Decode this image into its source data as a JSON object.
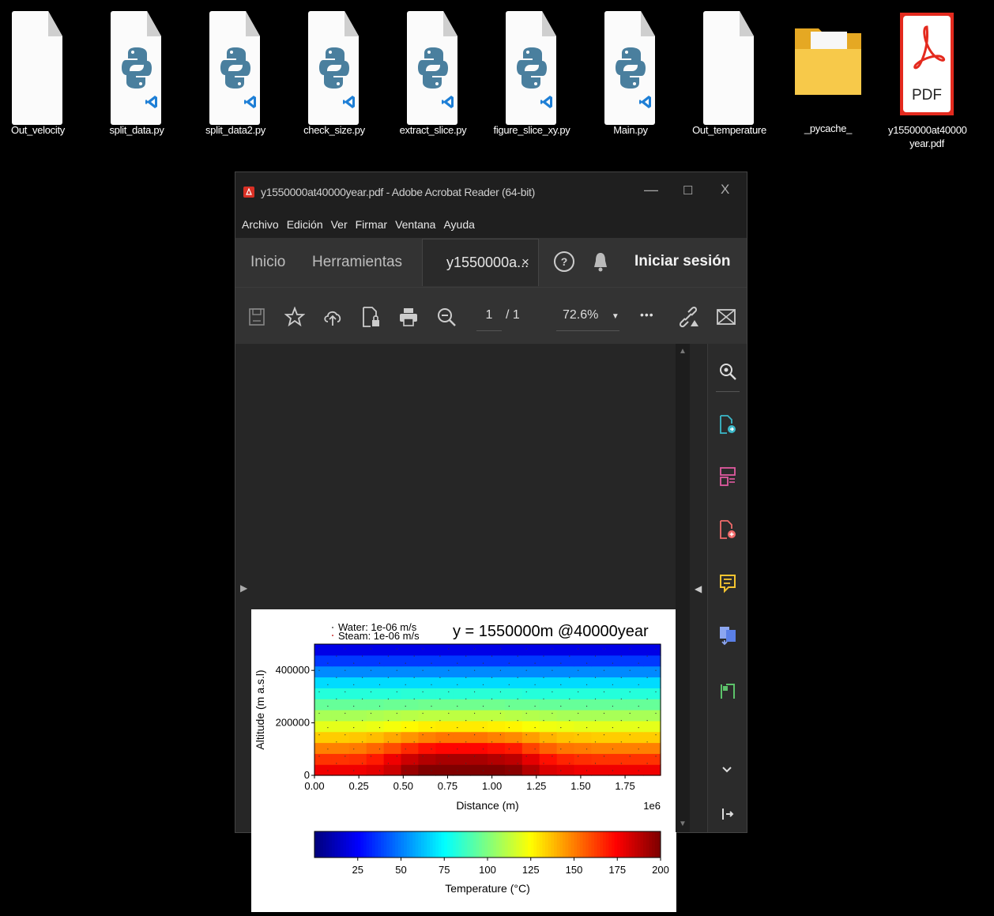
{
  "desktop": {
    "icons": [
      {
        "label": "Out_velocity",
        "kind": "blank"
      },
      {
        "label": "split_data.py",
        "kind": "python"
      },
      {
        "label": "split_data2.py",
        "kind": "python"
      },
      {
        "label": "check_size.py",
        "kind": "python"
      },
      {
        "label": "extract_slice.py",
        "kind": "python"
      },
      {
        "label": "figure_slice_xy.py",
        "kind": "python"
      },
      {
        "label": "Main.py",
        "kind": "python"
      },
      {
        "label": "Out_temperature",
        "kind": "blank"
      },
      {
        "label": "_pycache_",
        "kind": "folder"
      },
      {
        "label": "y1550000at40000 year.pdf",
        "kind": "pdf"
      }
    ],
    "pdf_badge": "PDF"
  },
  "window": {
    "title": "y1550000at40000year.pdf - Adobe Acrobat Reader (64-bit)",
    "menu": [
      "Archivo",
      "Edición",
      "Ver",
      "Firmar",
      "Ventana",
      "Ayuda"
    ],
    "tabs": {
      "home": "Inicio",
      "tools": "Herramientas",
      "doc": "y1550000a...",
      "close": "×",
      "signin": "Iniciar sesión"
    },
    "toolbar": {
      "page_current": "1",
      "page_total": "/ 1",
      "zoom": "72.6%",
      "more": "•••"
    }
  },
  "figure": {
    "legend_water": "Water: 1e-06 m/s",
    "legend_steam": "Steam: 1e-06 m/s",
    "title": "y = 1550000m @40000year",
    "ylabel": "Altitude (m a.s.l)",
    "xlabel": "Distance (m)",
    "x_offset": "1e6",
    "cbar_label": "Temperature (°C)"
  },
  "chart_data": {
    "type": "heatmap",
    "title": "y = 1550000m @40000year",
    "xlabel": "Distance (m)",
    "ylabel": "Altitude (m a.s.l)",
    "x_ticks": [
      "0.00",
      "0.25",
      "0.50",
      "0.75",
      "1.00",
      "1.25",
      "1.50",
      "1.75"
    ],
    "x_ticks_values": [
      0,
      0.25,
      0.5,
      0.75,
      1.0,
      1.25,
      1.5,
      1.75
    ],
    "x_scale_label": "1e6",
    "y_ticks": [
      "0",
      "200000",
      "400000"
    ],
    "y_ticks_values": [
      0,
      200000,
      400000
    ],
    "xlim": [
      0,
      1.95
    ],
    "ylim": [
      0,
      500000
    ],
    "colorbar": {
      "label": "Temperature (°C)",
      "ticks": [
        "25",
        "50",
        "75",
        "100",
        "125",
        "150",
        "175",
        "200"
      ],
      "tick_values": [
        25,
        50,
        75,
        100,
        125,
        150,
        175,
        200
      ],
      "range": [
        0,
        200
      ],
      "colormap": "jet"
    },
    "legend": [
      "Water: 1e-06 m/s",
      "Steam: 1e-06 m/s"
    ],
    "bands_temperature_bottom_to_top": [
      [
        178,
        178,
        178,
        180,
        185,
        195,
        200,
        200,
        200,
        200,
        200,
        198,
        190,
        182,
        180,
        178,
        178,
        178,
        178,
        178
      ],
      [
        165,
        165,
        166,
        170,
        178,
        185,
        190,
        192,
        192,
        192,
        190,
        188,
        180,
        172,
        168,
        166,
        165,
        165,
        165,
        165
      ],
      [
        150,
        150,
        151,
        155,
        160,
        167,
        172,
        174,
        174,
        174,
        172,
        170,
        162,
        156,
        152,
        151,
        150,
        150,
        150,
        150
      ],
      [
        135,
        135,
        136,
        138,
        142,
        146,
        150,
        152,
        152,
        152,
        150,
        148,
        144,
        140,
        137,
        136,
        135,
        135,
        135,
        135
      ],
      [
        120,
        120,
        120,
        121,
        123,
        126,
        128,
        129,
        129,
        129,
        128,
        127,
        124,
        122,
        121,
        120,
        120,
        120,
        120,
        120
      ],
      [
        108,
        108,
        108,
        109,
        110,
        111,
        112,
        112,
        112,
        112,
        112,
        111,
        110,
        109,
        108,
        108,
        108,
        108,
        108,
        108
      ],
      [
        95,
        95,
        95,
        95,
        96,
        96,
        97,
        97,
        97,
        97,
        97,
        96,
        96,
        95,
        95,
        95,
        95,
        95,
        95,
        95
      ],
      [
        82,
        82,
        82,
        82,
        82,
        83,
        83,
        83,
        83,
        83,
        83,
        83,
        82,
        82,
        82,
        82,
        82,
        82,
        82,
        82
      ],
      [
        68,
        68,
        68,
        68,
        68,
        68,
        68,
        68,
        68,
        68,
        68,
        68,
        68,
        68,
        68,
        68,
        68,
        68,
        68,
        68
      ],
      [
        52,
        52,
        52,
        52,
        52,
        52,
        52,
        52,
        52,
        52,
        52,
        52,
        52,
        52,
        52,
        52,
        52,
        52,
        52,
        52
      ],
      [
        36,
        36,
        36,
        36,
        36,
        36,
        36,
        36,
        36,
        36,
        36,
        36,
        36,
        36,
        36,
        36,
        36,
        36,
        36,
        36
      ],
      [
        20,
        20,
        20,
        20,
        20,
        20,
        20,
        20,
        20,
        20,
        20,
        20,
        20,
        20,
        20,
        20,
        20,
        20,
        20,
        20
      ]
    ]
  }
}
